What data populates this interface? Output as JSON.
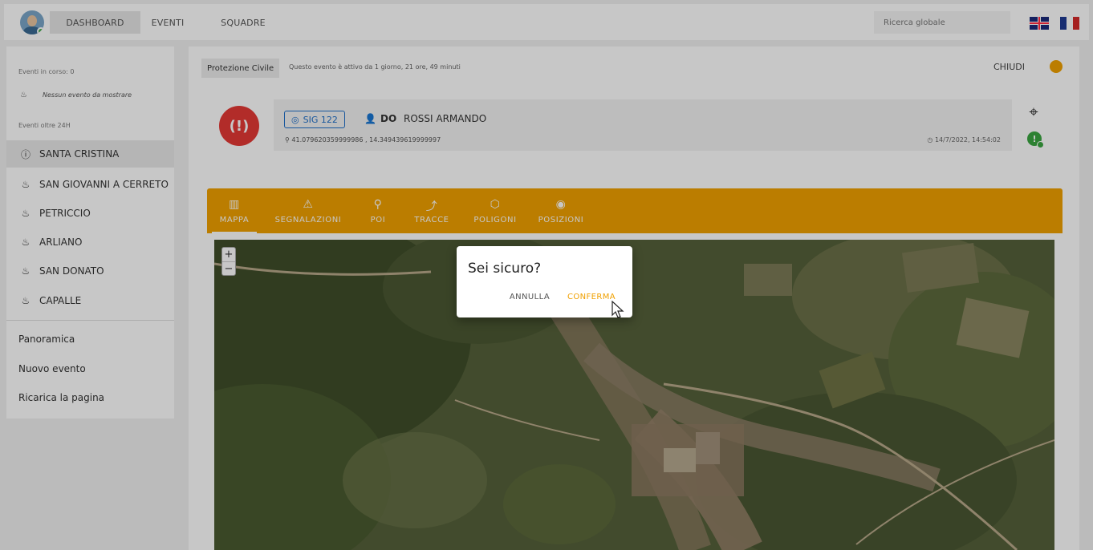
{
  "topbar": {
    "nav": {
      "dashboard": "DASHBOARD",
      "eventi": "EVENTI",
      "squadre": "SQUADRE"
    },
    "search_placeholder": "Ricerca globale",
    "flags": [
      "flag-uk",
      "flag-fr"
    ]
  },
  "sidebar": {
    "eventi_in_corso": "Eventi in corso: 0",
    "nessun_evento": "Nessun evento da mostrare",
    "eventi_oltre": "Eventi oltre 24H",
    "items": [
      {
        "label": "SANTA CRISTINA",
        "icon": "alert-circle-icon"
      },
      {
        "label": "SAN GIOVANNI A CERRETO",
        "icon": "fire-icon"
      },
      {
        "label": "PETRICCIO",
        "icon": "fire-icon"
      },
      {
        "label": "ARLIANO",
        "icon": "fire-icon"
      },
      {
        "label": "SAN DONATO",
        "icon": "fire-icon"
      },
      {
        "label": "CAPALLE",
        "icon": "fire-icon"
      }
    ],
    "links": [
      "Panoramica",
      "Nuovo evento",
      "Ricarica la pagina"
    ]
  },
  "event": {
    "category": "Protezione Civile",
    "active_since": "Questo evento è attivo da 1 giorno, 21 ore, 49 minuti",
    "close_label": "CHIUDI",
    "status_color": "#f0a000"
  },
  "report": {
    "signal": "SIG 122",
    "role": "DO",
    "person": "ROSSI ARMANDO",
    "coordinates": "41.079620359999986 , 14.349439619999997",
    "timestamp": "14/7/2022, 14:54:02"
  },
  "tabs": [
    {
      "label": "MAPPA",
      "icon": "map-icon"
    },
    {
      "label": "SEGNALAZIONI",
      "icon": "warning-icon"
    },
    {
      "label": "POI",
      "icon": "pin-icon"
    },
    {
      "label": "TRACCE",
      "icon": "route-icon"
    },
    {
      "label": "POLIGONI",
      "icon": "polygon-icon"
    },
    {
      "label": "POSIZIONI",
      "icon": "position-icon"
    }
  ],
  "map": {
    "zoom_in": "+",
    "zoom_out": "−"
  },
  "dialog": {
    "title": "Sei sicuro?",
    "cancel": "ANNULLA",
    "confirm": "CONFERMA"
  },
  "colors": {
    "accent": "#f0a000",
    "alarm": "#e53935",
    "link_blue": "#1e6fc9",
    "ok_green": "#3aa640"
  }
}
